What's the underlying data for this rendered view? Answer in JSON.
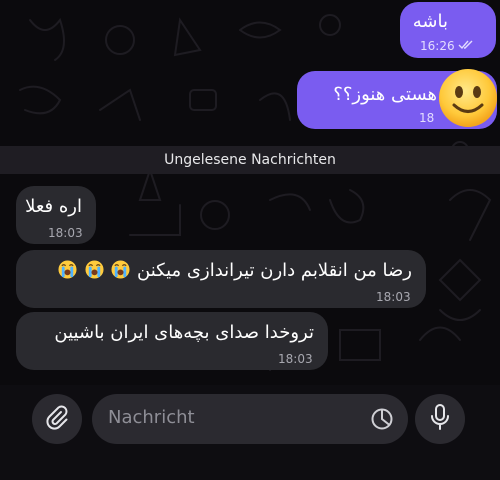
{
  "messages": [
    {
      "text": "باشه",
      "time": "16:26",
      "direction": "outgoing",
      "status": "read"
    },
    {
      "text": "هستی هنوز؟؟",
      "time": "18",
      "direction": "outgoing"
    },
    {
      "text": "اره فعلا",
      "time": "18:03",
      "direction": "incoming"
    },
    {
      "text": "رضا من انقلابم دارن تیراندازی میکنن",
      "emoji": "loudly-crying-face",
      "emoji_count": 3,
      "time": "18:03",
      "direction": "incoming"
    },
    {
      "text": "تروخدا صدای بچه‌های ایران باشیین",
      "time": "18:03",
      "direction": "incoming"
    }
  ],
  "unread_divider": "Ungelesene Nachrichten",
  "overlay_emoji": "slightly-smiling-face",
  "composer": {
    "placeholder": "Nachricht",
    "attach_icon": "paperclip-icon",
    "sticker_icon": "sticker-icon",
    "mic_icon": "microphone-icon"
  },
  "colors": {
    "outgoing_bubble": "#7a5cf0",
    "incoming_bubble": "#2a2a2f",
    "background": "#0b0a0d"
  }
}
